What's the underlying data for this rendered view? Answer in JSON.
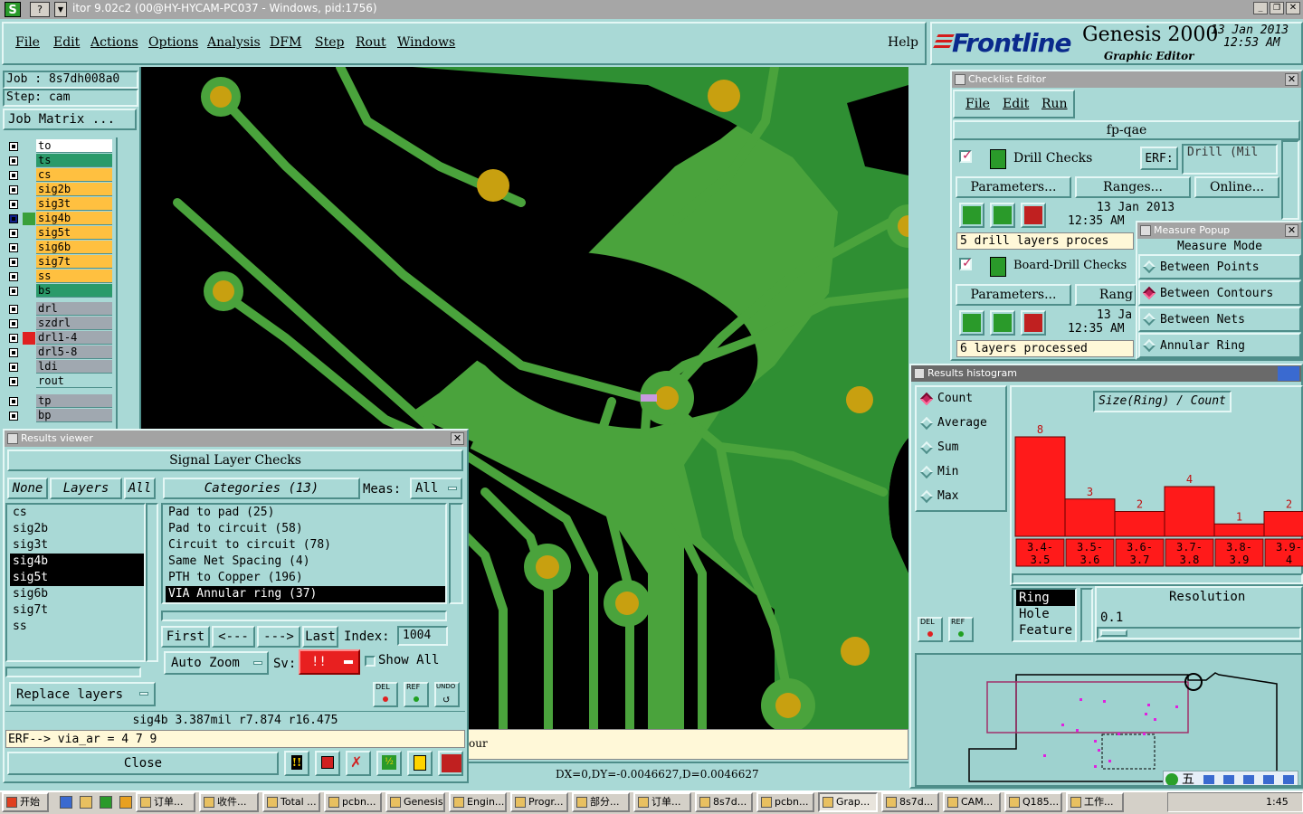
{
  "titlebar": {
    "text": "itor 9.02c2 (00@HY-HYCAM-PC037 - Windows, pid:1756)"
  },
  "menu": {
    "items": [
      "File",
      "Edit",
      "Actions",
      "Options",
      "Analysis",
      "DFM",
      "Step",
      "Rout",
      "Windows"
    ],
    "help": "Help"
  },
  "brand": {
    "logo": "Frontline",
    "product": "Genesis 2000",
    "subtitle": "Graphic Editor",
    "date": "13 Jan 2013",
    "time": "12:53 AM"
  },
  "job": {
    "job": "Job : 8s7dh008a0",
    "step": "Step: cam",
    "matrix_btn": "Job Matrix ..."
  },
  "layers": {
    "group1": [
      "to",
      "ts",
      "cs",
      "sig2b",
      "sig3t",
      "sig4b",
      "sig5t",
      "sig6b",
      "sig7t",
      "ss",
      "bs"
    ],
    "group2": [
      "drl",
      "szdrl",
      "drl1-4",
      "drl5-8",
      "ldi",
      "rout"
    ],
    "group3": [
      "tp",
      "bp"
    ]
  },
  "results_viewer": {
    "title": "Results viewer",
    "header": "Signal Layer Checks",
    "none_btn": "None",
    "layers_label": "Layers",
    "all_btn": "All",
    "categories_label": "Categories (13)",
    "meas_label": "Meas:",
    "meas_value": "All",
    "layer_list": [
      "cs",
      "sig2b",
      "sig3t",
      "sig4b",
      "sig5t",
      "sig6b",
      "sig7t",
      "ss"
    ],
    "categories": [
      "Pad to pad (25)",
      "Pad to circuit (58)",
      "Circuit to circuit (78)",
      "Same Net Spacing (4)",
      "PTH to Copper (196)",
      "VIA Annular ring (37)"
    ],
    "first_btn": "First",
    "prev_btn": "<---",
    "next_btn": "--->",
    "last_btn": "Last",
    "index_label": "Index:",
    "index_value": "1004",
    "autozoom_btn": "Auto Zoom",
    "sv_label": "Sv:",
    "sv_value": "!!",
    "showall_label": "Show All",
    "replace_btn": "Replace layers",
    "del_label": "DEL",
    "ref_label": "REF",
    "undo_label": "UNDO",
    "status": "sig4b 3.387mil  r7.874  r16.475",
    "erf_line": "ERF--> via_ar = 4 7 9",
    "close_btn": "Close"
  },
  "canvas_status": {
    "side_text": "our",
    "coords": "DX=0,DY=-0.0046627,D=0.0046627"
  },
  "checklist": {
    "title": "Checklist Editor",
    "menu": [
      "File",
      "Edit",
      "Run"
    ],
    "name": "fp-qae",
    "erf_label": "ERF:",
    "items": [
      {
        "name": "Drill Checks",
        "erf": "Drill (Mil",
        "params": "Parameters...",
        "ranges": "Ranges...",
        "online": "Online...",
        "date": "13 Jan 2013",
        "time": "12:35 AM",
        "status": "5 drill layers proces"
      },
      {
        "name": "Board-Drill Checks",
        "params": "Parameters...",
        "ranges": "Rang",
        "date": "13 Ja",
        "time": "12:35 AM",
        "status": "6 layers processed"
      }
    ]
  },
  "measure": {
    "title": "Measure Popup",
    "heading": "Measure Mode",
    "options": [
      "Between Points",
      "Between Contours",
      "Between Nets",
      "Annular Ring"
    ],
    "selected": 1
  },
  "histogram": {
    "title": "Results histogram",
    "modes": [
      "Count",
      "Average",
      "Sum",
      "Min",
      "Max"
    ],
    "selected_mode": 0,
    "graph_title": "Size(Ring) / Count",
    "list": [
      "Ring",
      "Hole",
      "Feature"
    ],
    "resolution_label": "Resolution",
    "resolution_value": "0.1",
    "del_label": "DEL",
    "ref_label": "REF"
  },
  "chart_data": {
    "type": "bar",
    "title": "Size(Ring) / Count",
    "categories": [
      "3.4- 3.5",
      "3.5- 3.6",
      "3.6- 3.7",
      "3.7- 3.8",
      "3.8- 3.9",
      "3.9- 4"
    ],
    "values": [
      8,
      3,
      2,
      4,
      1,
      2
    ],
    "bar_color": "#ff1a1a"
  },
  "ime": {
    "text": "五"
  },
  "taskbar": {
    "start": "开始",
    "items": [
      "订单...",
      "收件...",
      "Total ...",
      "pcbn...",
      "Genesis",
      "Engin...",
      "Progr...",
      "部分...",
      "订单...",
      "8s7d...",
      "pcbn...",
      "Grap...",
      "8s7d...",
      "CAM...",
      "Q185...",
      "工作..."
    ],
    "clock": "1:45"
  }
}
